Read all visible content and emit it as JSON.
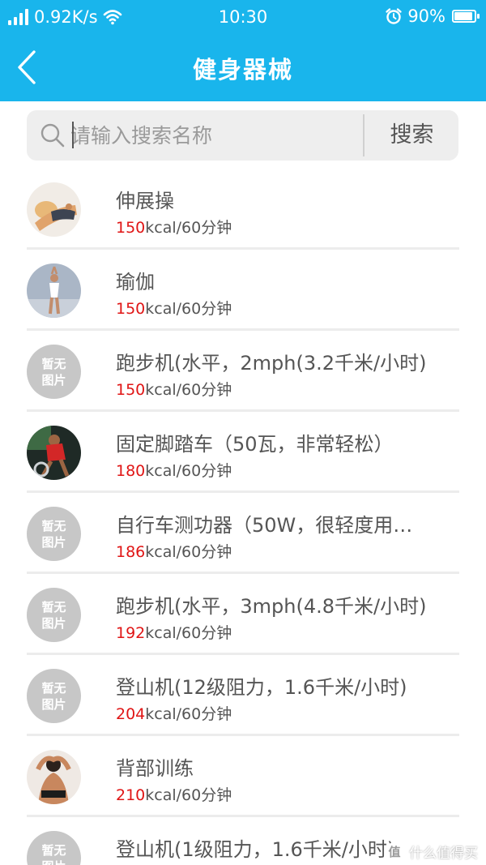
{
  "status_bar": {
    "speed": "0.92K/s",
    "time": "10:30",
    "battery": "90%",
    "battery_level": 0.9
  },
  "nav": {
    "title": "健身器械"
  },
  "search": {
    "placeholder": "请输入搜索名称",
    "button_label": "搜索"
  },
  "items": [
    {
      "name": "伸展操",
      "kcal": "150",
      "unit": "kcal/60分钟",
      "image": "photo",
      "no_image_label": ""
    },
    {
      "name": "瑜伽",
      "kcal": "150",
      "unit": "kcal/60分钟",
      "image": "photo",
      "no_image_label": ""
    },
    {
      "name": "跑步机(水平，2mph(3.2千米/小时)",
      "kcal": "150",
      "unit": "kcal/60分钟",
      "image": "none",
      "no_image_label": "暂无图片"
    },
    {
      "name": "固定脚踏车（50瓦，非常轻松）",
      "kcal": "180",
      "unit": "kcal/60分钟",
      "image": "photo",
      "no_image_label": ""
    },
    {
      "name": "自行车测功器（50W，很轻度用…",
      "kcal": "186",
      "unit": "kcal/60分钟",
      "image": "none",
      "no_image_label": "暂无图片"
    },
    {
      "name": "跑步机(水平，3mph(4.8千米/小时)",
      "kcal": "192",
      "unit": "kcal/60分钟",
      "image": "none",
      "no_image_label": "暂无图片"
    },
    {
      "name": "登山机(12级阻力，1.6千米/小时)",
      "kcal": "204",
      "unit": "kcal/60分钟",
      "image": "none",
      "no_image_label": "暂无图片"
    },
    {
      "name": "背部训练",
      "kcal": "210",
      "unit": "kcal/60分钟",
      "image": "photo",
      "no_image_label": ""
    },
    {
      "name": "登山机(1级阻力，1.6千米/小时)",
      "kcal": "",
      "unit": "",
      "image": "none",
      "no_image_label": "暂无图片"
    }
  ],
  "watermark": {
    "badge": "值",
    "text": "什么值得买"
  },
  "colors": {
    "accent": "#19b5ec",
    "kcal_value": "#e01515",
    "placeholder_avatar": "#c7c7c7"
  }
}
